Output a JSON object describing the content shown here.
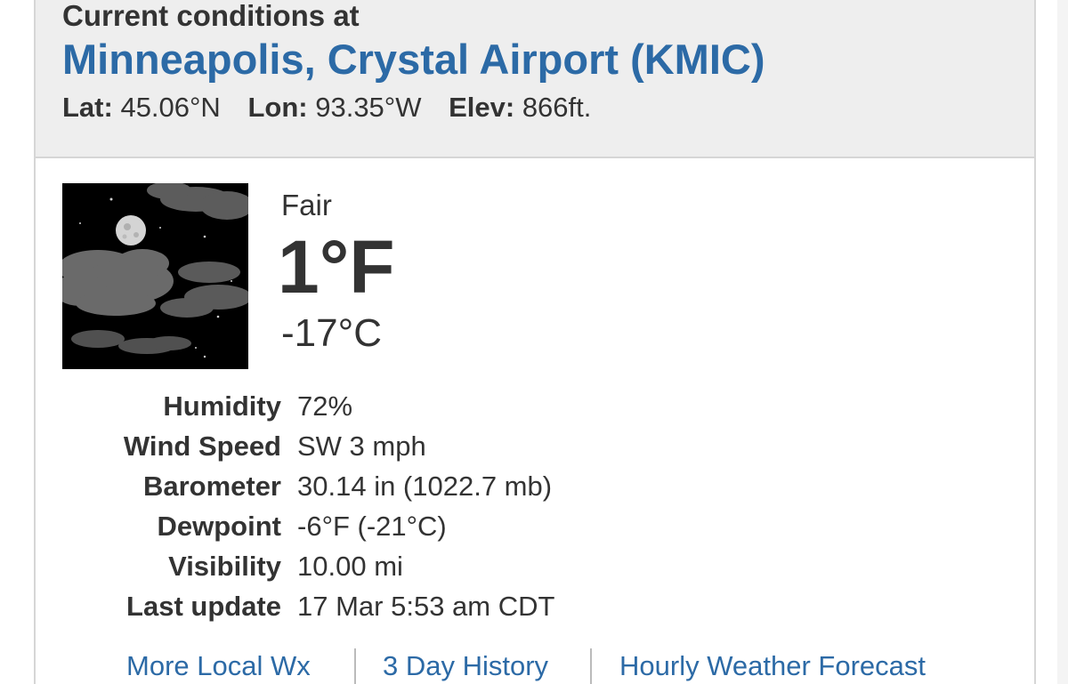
{
  "header": {
    "label": "Current conditions at",
    "station": "Minneapolis, Crystal Airport (KMIC)",
    "lat_label": "Lat:",
    "lat_value": "45.06°N",
    "lon_label": "Lon:",
    "lon_value": "93.35°W",
    "elev_label": "Elev:",
    "elev_value": "866ft."
  },
  "current": {
    "icon": "night-partly-cloudy-moon-icon",
    "condition": "Fair",
    "temp_f": "1°F",
    "temp_c": "-17°C"
  },
  "details": [
    {
      "label": "Humidity",
      "value": "72%"
    },
    {
      "label": "Wind Speed",
      "value": "SW 3 mph"
    },
    {
      "label": "Barometer",
      "value": "30.14 in (1022.7 mb)"
    },
    {
      "label": "Dewpoint",
      "value": "-6°F (-21°C)"
    },
    {
      "label": "Visibility",
      "value": "10.00 mi"
    },
    {
      "label": "Last update",
      "value": "17 Mar 5:53 am CDT"
    }
  ],
  "links": [
    {
      "label": "More Local Wx"
    },
    {
      "label": "3 Day History"
    },
    {
      "label": "Hourly Weather Forecast"
    }
  ],
  "colors": {
    "link": "#2c6aa6",
    "heading_bg": "#eeeeee",
    "text": "#333333"
  }
}
